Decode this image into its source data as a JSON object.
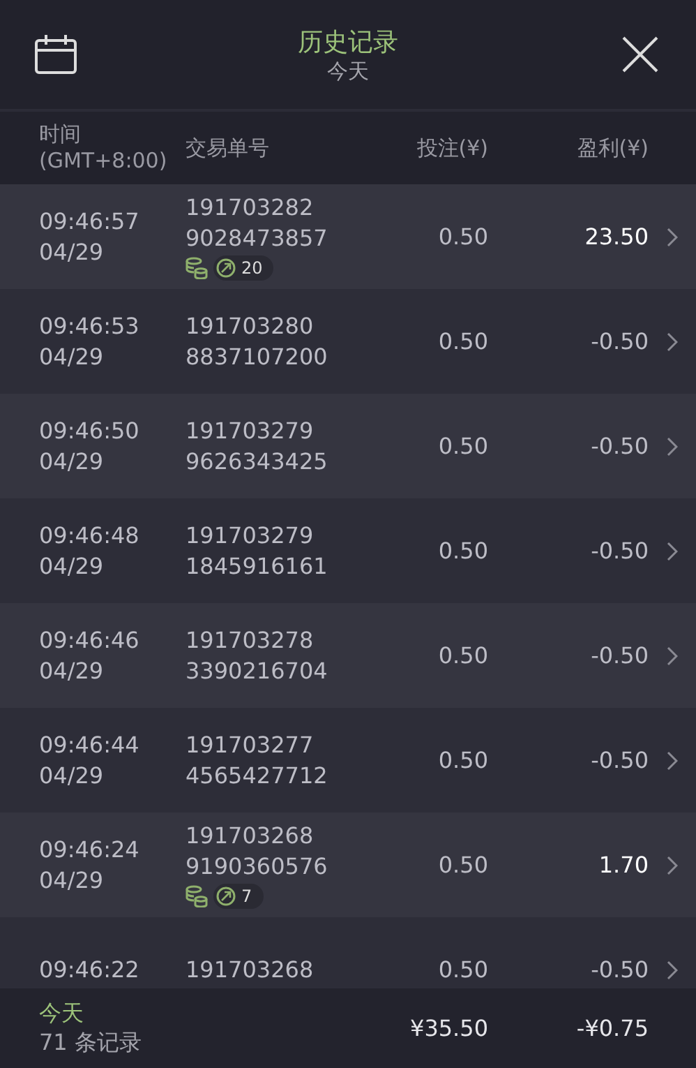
{
  "header": {
    "title": "历史记录",
    "subtitle": "今天"
  },
  "columns": [
    "时间\n(GMT+8:00)",
    "交易单号",
    "投注(¥)",
    "盈利(¥)"
  ],
  "rows": [
    {
      "time": "09:46:57",
      "date": "04/29",
      "order_1": "191703282",
      "order_2": "9028473857",
      "stake": "0.50",
      "profit": "23.50",
      "win": true,
      "badge": "20"
    },
    {
      "time": "09:46:53",
      "date": "04/29",
      "order_1": "191703280",
      "order_2": "8837107200",
      "stake": "0.50",
      "profit": "-0.50",
      "win": false
    },
    {
      "time": "09:46:50",
      "date": "04/29",
      "order_1": "191703279",
      "order_2": "9626343425",
      "stake": "0.50",
      "profit": "-0.50",
      "win": false
    },
    {
      "time": "09:46:48",
      "date": "04/29",
      "order_1": "191703279",
      "order_2": "1845916161",
      "stake": "0.50",
      "profit": "-0.50",
      "win": false
    },
    {
      "time": "09:46:46",
      "date": "04/29",
      "order_1": "191703278",
      "order_2": "3390216704",
      "stake": "0.50",
      "profit": "-0.50",
      "win": false
    },
    {
      "time": "09:46:44",
      "date": "04/29",
      "order_1": "191703277",
      "order_2": "4565427712",
      "stake": "0.50",
      "profit": "-0.50",
      "win": false
    },
    {
      "time": "09:46:24",
      "date": "04/29",
      "order_1": "191703268",
      "order_2": "9190360576",
      "stake": "0.50",
      "profit": "1.70",
      "win": true,
      "badge": "7"
    },
    {
      "time": "09:46:22",
      "order_1": "191703268",
      "stake": "0.50",
      "profit": "-0.50",
      "win": false
    }
  ],
  "footer": {
    "period": "今天",
    "count": "71 条记录",
    "total_stake": "¥35.50",
    "total_profit": "-¥0.75"
  }
}
